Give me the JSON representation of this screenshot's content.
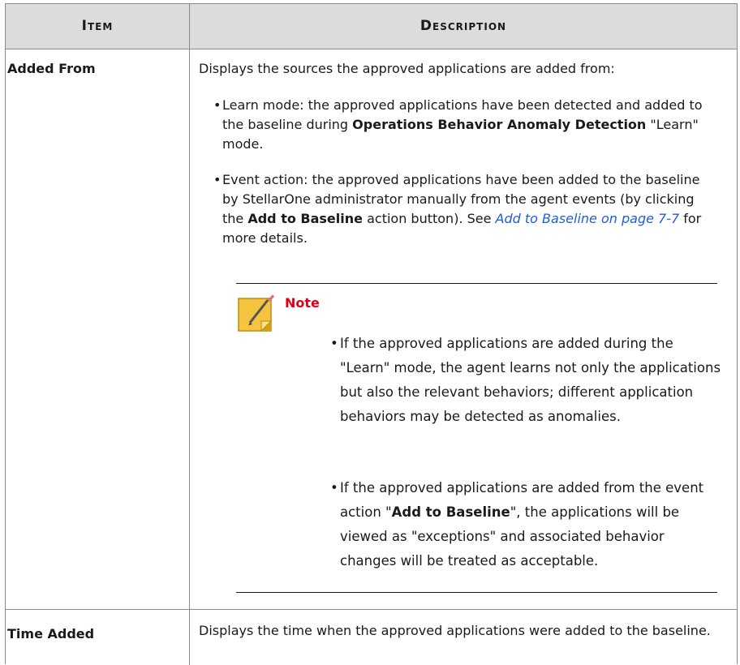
{
  "table": {
    "header": {
      "item": "Item",
      "description": "Description"
    },
    "rows": [
      {
        "item": "Added From",
        "intro": "Displays the sources the approved applications are added from:",
        "bullets": [
          {
            "part1": "Learn mode: the approved applications have been detected and added to the baseline during ",
            "bold1": "Operations Behavior Anomaly Detection",
            "part2": " \"Learn\" mode."
          },
          {
            "part1": "Event action: the approved applications have been added to the baseline by StellarOne administrator manually from the agent events (by clicking the ",
            "bold1": "Add to Baseline",
            "part2": " action button). See ",
            "link": "Add to Baseline on page 7-7",
            "part3": " for more details."
          }
        ],
        "note": {
          "title": "Note",
          "bullets": [
            {
              "text": "If the approved applications are added during the \"Learn\" mode, the agent learns not only the applications but also the relevant behaviors; different application behaviors may be detected as anomalies."
            },
            {
              "part1": "If the approved applications are added from the event action \"",
              "bold1": "Add to Baseline",
              "part2": "\", the applications will be viewed as \"exceptions\" and associated behavior changes will be treated as acceptable."
            }
          ]
        }
      },
      {
        "item": "Time Added",
        "intro": "Displays the time when the approved applications were added to the baseline."
      }
    ]
  },
  "colors": {
    "header_bg": "#dcdcdc",
    "note_title": "#e0001a",
    "link": "#1f5ed6",
    "note_icon": "#f5c542"
  }
}
